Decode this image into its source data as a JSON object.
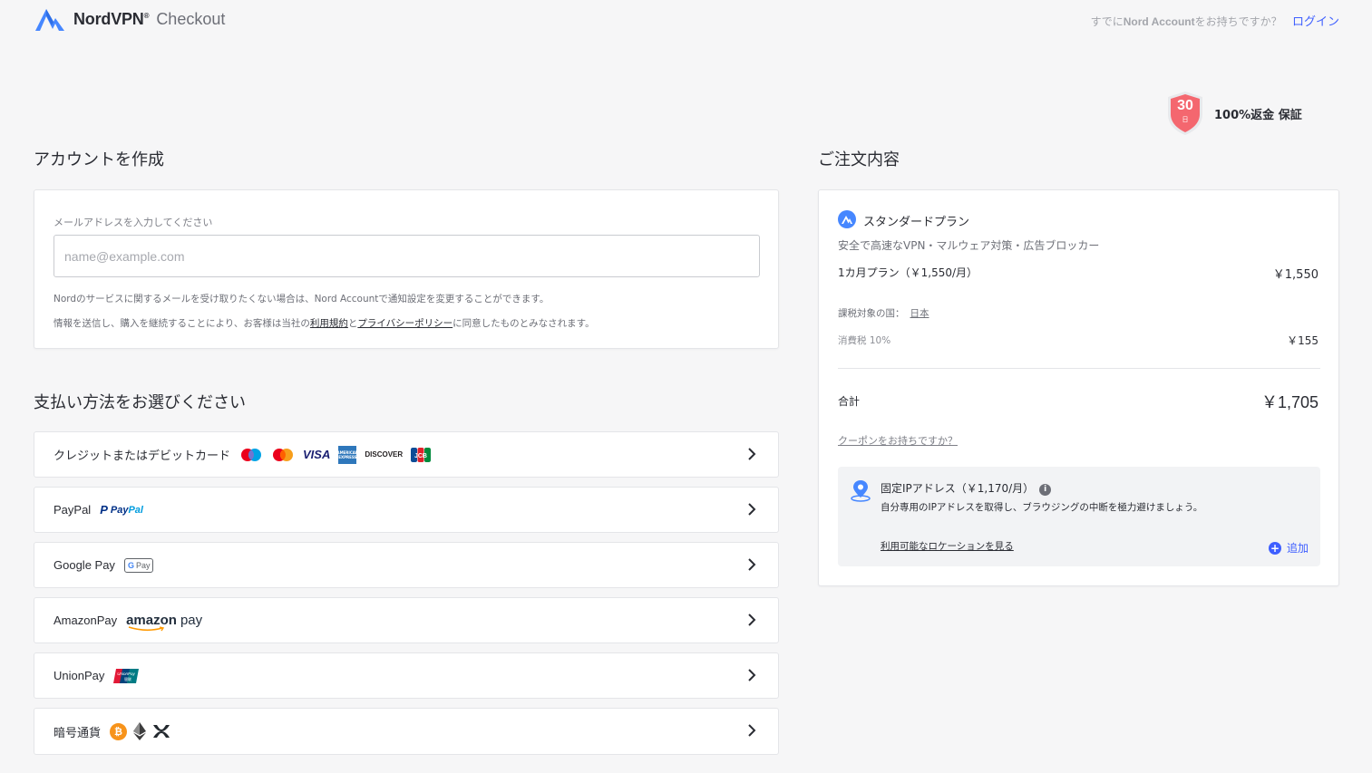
{
  "header": {
    "brand": "NordVPN",
    "reg_mark": "®",
    "checkout": "Checkout",
    "login_prompt_prefix": "すでに",
    "login_prompt_brand": "Nord Account",
    "login_prompt_suffix": "をお持ちですか？",
    "login_link": "ログイン"
  },
  "guarantee": {
    "days": "30",
    "day_unit": "日",
    "label": "100%返金 保証"
  },
  "account": {
    "title": "アカウントを作成",
    "email_label": "メールアドレスを入力してください",
    "email_placeholder": "name@example.com",
    "email_value": "",
    "note1": "Nordのサービスに関するメールを受け取りたくない場合は、Nord Accountで通知設定を変更することができます。",
    "note2_prefix": "情報を送信し、購入を継続することにより、お客様は当社の",
    "terms_link": "利用規約",
    "note2_and": "と",
    "privacy_link": "プライバシーポリシー",
    "note2_suffix": "に同意したものとみなされます。"
  },
  "payment": {
    "title": "支払い方法をお選びください",
    "methods": [
      {
        "name": "クレジットまたはデビットカード",
        "logos": [
          "maestro-logo",
          "mastercard-logo",
          "visa-logo",
          "amex-logo",
          "discover-logo",
          "jcb-logo"
        ]
      },
      {
        "name": "PayPal",
        "logos": [
          "paypal-logo"
        ]
      },
      {
        "name": "Google Pay",
        "logos": [
          "google-pay-logo"
        ]
      },
      {
        "name": "AmazonPay",
        "logos": [
          "amazon-pay-logo"
        ]
      },
      {
        "name": "UnionPay",
        "logos": [
          "unionpay-logo"
        ]
      },
      {
        "name": "暗号通貨",
        "logos": [
          "bitcoin-logo",
          "ethereum-logo",
          "ripple-logo"
        ]
      }
    ],
    "logo_text": {
      "visa": "VISA",
      "amex": "AMERICAN EXPRESS",
      "discover": "DISCOVER",
      "jcb": "JCB",
      "paypal_p": "P",
      "paypal_pay": "Pay",
      "paypal_pal": "Pal",
      "gpay_g": "G",
      "gpay_pay": "Pay",
      "amazon": "amazon",
      "amazon_pay": "pay",
      "unionpay": "UnionPay",
      "unionpay_cn": "银联",
      "bitcoin": "₿"
    }
  },
  "order": {
    "title": "ご注文内容",
    "plan_name": "スタンダードプラン",
    "plan_desc": "安全で高速なVPN・マルウェア対策・広告ブロッカー",
    "plan_line": "1カ月プラン（￥1,550/月）",
    "plan_price": "￥1,550",
    "tax_country_label": "課税対象の国：",
    "tax_country": "日本",
    "tax_label": "消費税 10%",
    "tax_value": "￥155",
    "total_label": "合計",
    "total_value": "￥1,705",
    "coupon": "クーポンをお持ちですか？",
    "addon": {
      "title": "固定IPアドレス（￥1,170/月）",
      "info": "i",
      "desc": "自分専用のIPアドレスを取得し、ブラウジングの中断を極力避けましょう。",
      "link": "利用可能なロケーションを見る",
      "add_icon": "+",
      "add": "追加"
    }
  },
  "colors": {
    "accent": "#3e5fff",
    "background": "#f6f6f7",
    "badge": "#f4676f",
    "nord_blue": "#4687ff"
  }
}
